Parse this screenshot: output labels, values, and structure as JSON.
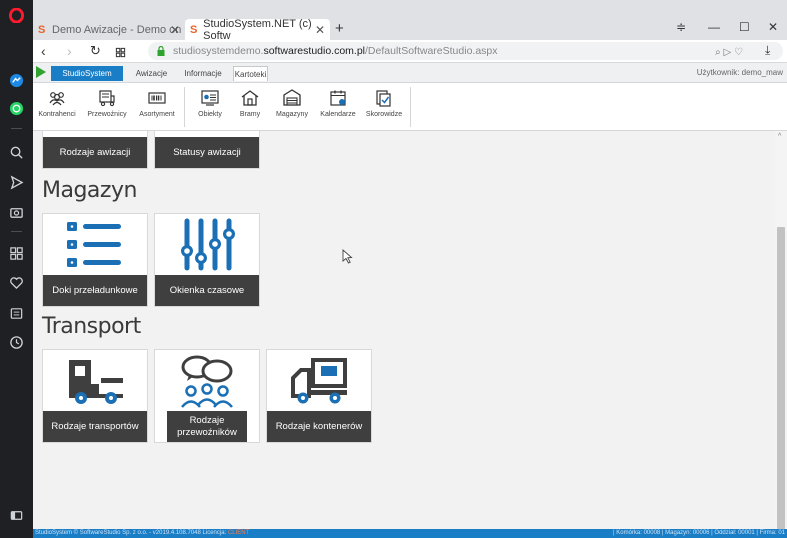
{
  "browser": {
    "tabs": [
      {
        "label": "Demo Awizacje - Demo on",
        "favicon": "S"
      },
      {
        "label": "StudioSystem.NET (c) Softw",
        "favicon": "S"
      }
    ],
    "url": {
      "prefix": "studiosystemdemo.",
      "host": "softwarestudio.com.pl",
      "path": "/DefaultSoftwareStudio.aspx"
    }
  },
  "app": {
    "menu": [
      "StudioSystem",
      "Awizacje",
      "Informacje",
      "Kartoteki"
    ],
    "user": "Użytkownik: demo_maw",
    "ribbon": [
      "Kontrahenci",
      "Przewoźnicy",
      "Asortyment",
      "Obiekty",
      "Bramy",
      "Magazyny",
      "Kalendarze",
      "Skorowidze"
    ]
  },
  "sections": {
    "awizacje_tiles": [
      "Rodzaje awizacji",
      "Statusy awizacji"
    ],
    "magazyn": {
      "title": "Magazyn",
      "tiles": [
        "Doki przeładunkowe",
        "Okienka czasowe"
      ]
    },
    "transport": {
      "title": "Transport",
      "tiles": [
        "Rodzaje transportów",
        "Rodzaje przewoźników",
        "Rodzaje kontenerów"
      ]
    }
  },
  "status": {
    "left": "StudioSystem © SoftwareStudio Sp. z o.o. - v2019.4.108.7048",
    "license_label": "Licencja:",
    "license": "CLIENT",
    "right": "| Komórka: 00008 | Magazyn: 00006 | Oddział: 00001 | Firma: 01"
  },
  "colors": {
    "accent": "#1a7ec7",
    "tile_label_bg": "#3f3f3f",
    "icon_blue": "#1a6fb5"
  }
}
